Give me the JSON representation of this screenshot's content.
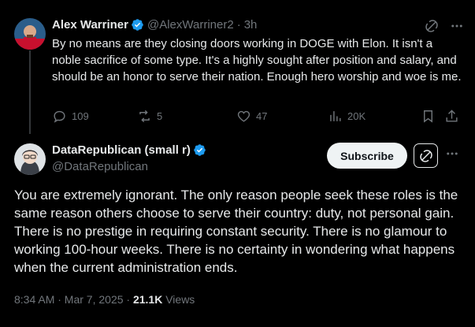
{
  "reply": {
    "author_name": "Alex Warriner",
    "handle": "@AlexWarriner2",
    "separator": "·",
    "time": "3h",
    "text": "By no means are they closing doors working in DOGE with Elon. It isn't a noble sacrifice of some type. It's a highly sought after position and salary, and should be an honor to serve their nation. Enough hero worship and woe is me.",
    "actions": {
      "replies": "109",
      "reposts": "5",
      "likes": "47",
      "views": "20K"
    }
  },
  "main": {
    "author_name": "DataRepublican (small r)",
    "handle": "@DataRepublican",
    "subscribe_label": "Subscribe",
    "text": "You are extremely ignorant. The only reason people seek these roles is the same reason others choose to serve their country: duty, not personal gain. There is no prestige in requiring constant security. There is no glamour to working 100-hour weeks. There is no certainty in wondering what happens when the current administration ends.",
    "timestamp": "8:34 AM · Mar 7, 2025 · ",
    "views_count": "21.1K",
    "views_label": " Views"
  },
  "colors": {
    "background": "#000000",
    "text": "#e7e9ea",
    "muted": "#71767b",
    "verified": "#1d9bf0"
  },
  "icons": [
    "grok-icon",
    "more-icon",
    "reply-icon",
    "repost-icon",
    "like-icon",
    "views-icon",
    "bookmark-icon",
    "share-icon",
    "verified-icon"
  ]
}
